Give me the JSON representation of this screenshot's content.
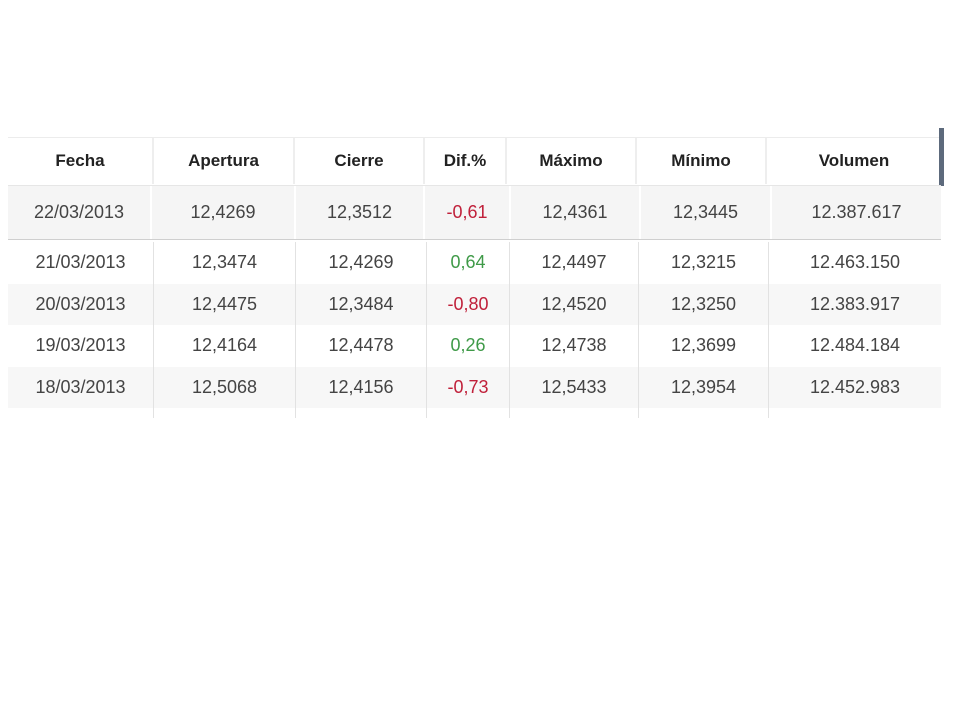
{
  "table": {
    "headers": [
      "Fecha",
      "Apertura",
      "Cierre",
      "Dif.%",
      "Máximo",
      "Mínimo",
      "Volumen"
    ],
    "first_row": {
      "fecha": "22/03/2013",
      "apertura": "12,4269",
      "cierre": "12,3512",
      "dif": "-0,61",
      "maximo": "12,4361",
      "minimo": "12,3445",
      "volumen": "12.387.617",
      "dif_sign": "neg"
    },
    "rows": [
      {
        "fecha": "21/03/2013",
        "apertura": "12,3474",
        "cierre": "12,4269",
        "dif": "0,64",
        "maximo": "12,4497",
        "minimo": "12,3215",
        "volumen": "12.463.150",
        "dif_sign": "pos"
      },
      {
        "fecha": "20/03/2013",
        "apertura": "12,4475",
        "cierre": "12,3484",
        "dif": "-0,80",
        "maximo": "12,4520",
        "minimo": "12,3250",
        "volumen": "12.383.917",
        "dif_sign": "neg"
      },
      {
        "fecha": "19/03/2013",
        "apertura": "12,4164",
        "cierre": "12,4478",
        "dif": "0,26",
        "maximo": "12,4738",
        "minimo": "12,3699",
        "volumen": "12.484.184",
        "dif_sign": "pos"
      },
      {
        "fecha": "18/03/2013",
        "apertura": "12,5068",
        "cierre": "12,4156",
        "dif": "-0,73",
        "maximo": "12,5433",
        "minimo": "12,3954",
        "volumen": "12.452.983",
        "dif_sign": "neg"
      }
    ]
  },
  "colors": {
    "negative": "#c0203a",
    "positive": "#3f9a48",
    "text": "#444444",
    "header_text": "#222222",
    "scroll_marker": "#5d6a7c"
  }
}
